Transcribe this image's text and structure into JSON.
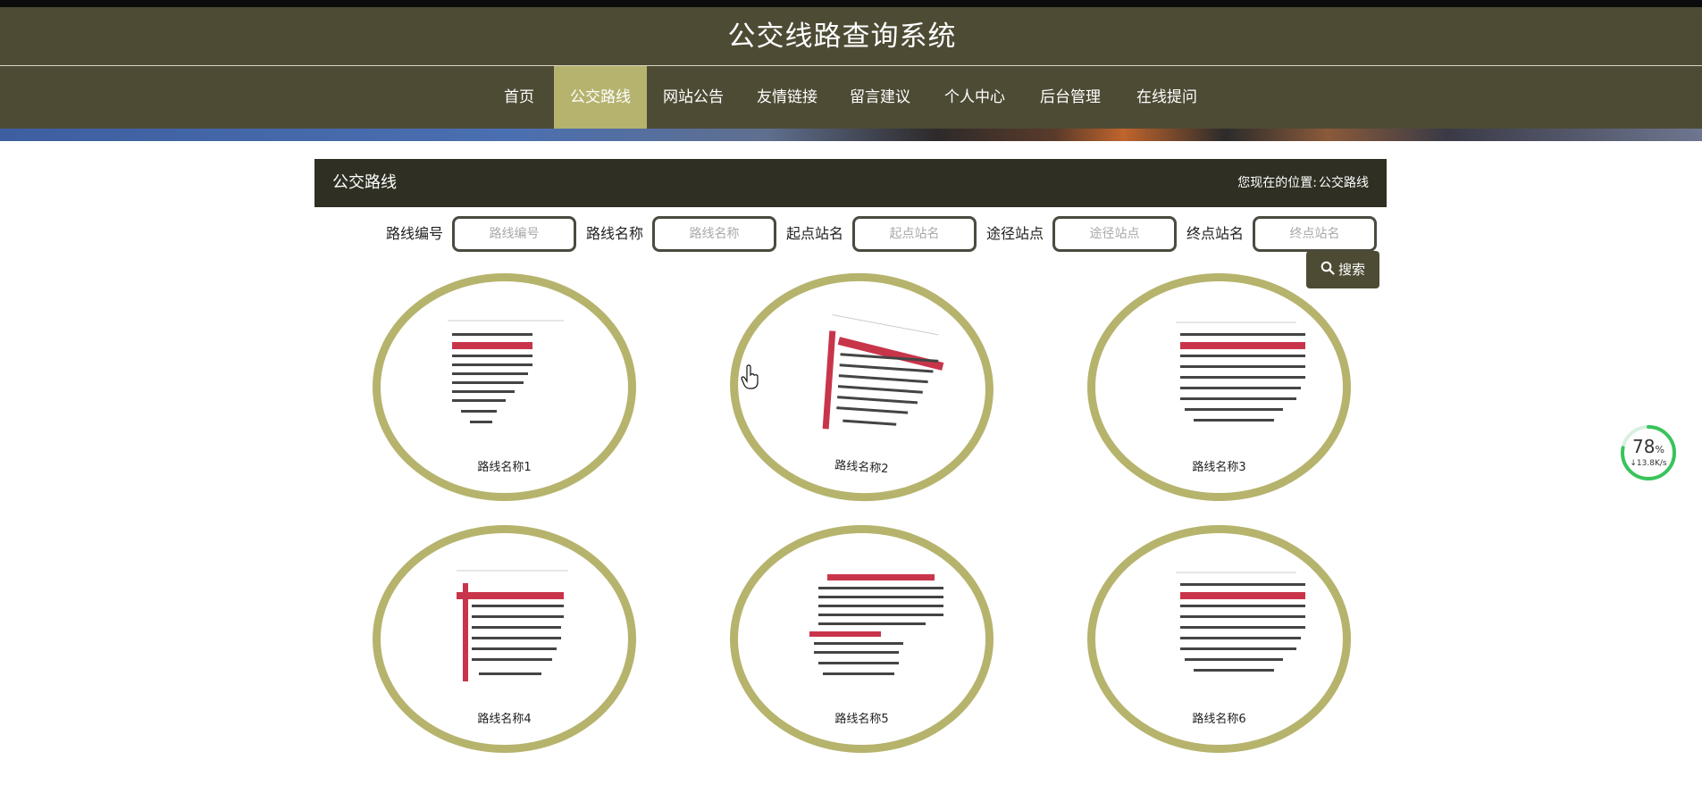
{
  "header": {
    "site_title": "公交线路查询系统"
  },
  "nav": {
    "items": [
      {
        "label": "首页",
        "active": false
      },
      {
        "label": "公交路线",
        "active": true
      },
      {
        "label": "网站公告",
        "active": false
      },
      {
        "label": "友情链接",
        "active": false
      },
      {
        "label": "留言建议",
        "active": false
      },
      {
        "label": "个人中心",
        "active": false
      },
      {
        "label": "后台管理",
        "active": false
      },
      {
        "label": "在线提问",
        "active": false
      }
    ]
  },
  "section": {
    "title": "公交路线",
    "location_label": "您现在的位置:",
    "location_value": "公交路线"
  },
  "search": {
    "fields": [
      {
        "label": "路线编号",
        "placeholder": "路线编号",
        "value": ""
      },
      {
        "label": "路线名称",
        "placeholder": "路线名称",
        "value": ""
      },
      {
        "label": "起点站名",
        "placeholder": "起点站名",
        "value": ""
      },
      {
        "label": "途径站点",
        "placeholder": "途径站点",
        "value": ""
      },
      {
        "label": "终点站名",
        "placeholder": "终点站名",
        "value": ""
      }
    ],
    "button_label": "搜索",
    "button_icon": "search-icon"
  },
  "routes": [
    {
      "name": "路线名称1",
      "thumb_style": "left-red"
    },
    {
      "name": "路线名称2",
      "thumb_style": "red-cross"
    },
    {
      "name": "路线名称3",
      "thumb_style": "plain"
    },
    {
      "name": "路线名称4",
      "thumb_style": "red-cross"
    },
    {
      "name": "路线名称5",
      "thumb_style": "double-band"
    },
    {
      "name": "路线名称6",
      "thumb_style": "plain"
    }
  ],
  "speed_widget": {
    "percent": "78",
    "percent_unit": "%",
    "rate": "↓13.8K/s",
    "progress": 0.78
  },
  "colors": {
    "header_bg": "#4e4b35",
    "nav_active": "#b6b36f",
    "section_header_bg": "#2f3023",
    "oval_border": "#b6b36d",
    "thumb_red": "#c8354a",
    "widget_green": "#39c45a"
  }
}
